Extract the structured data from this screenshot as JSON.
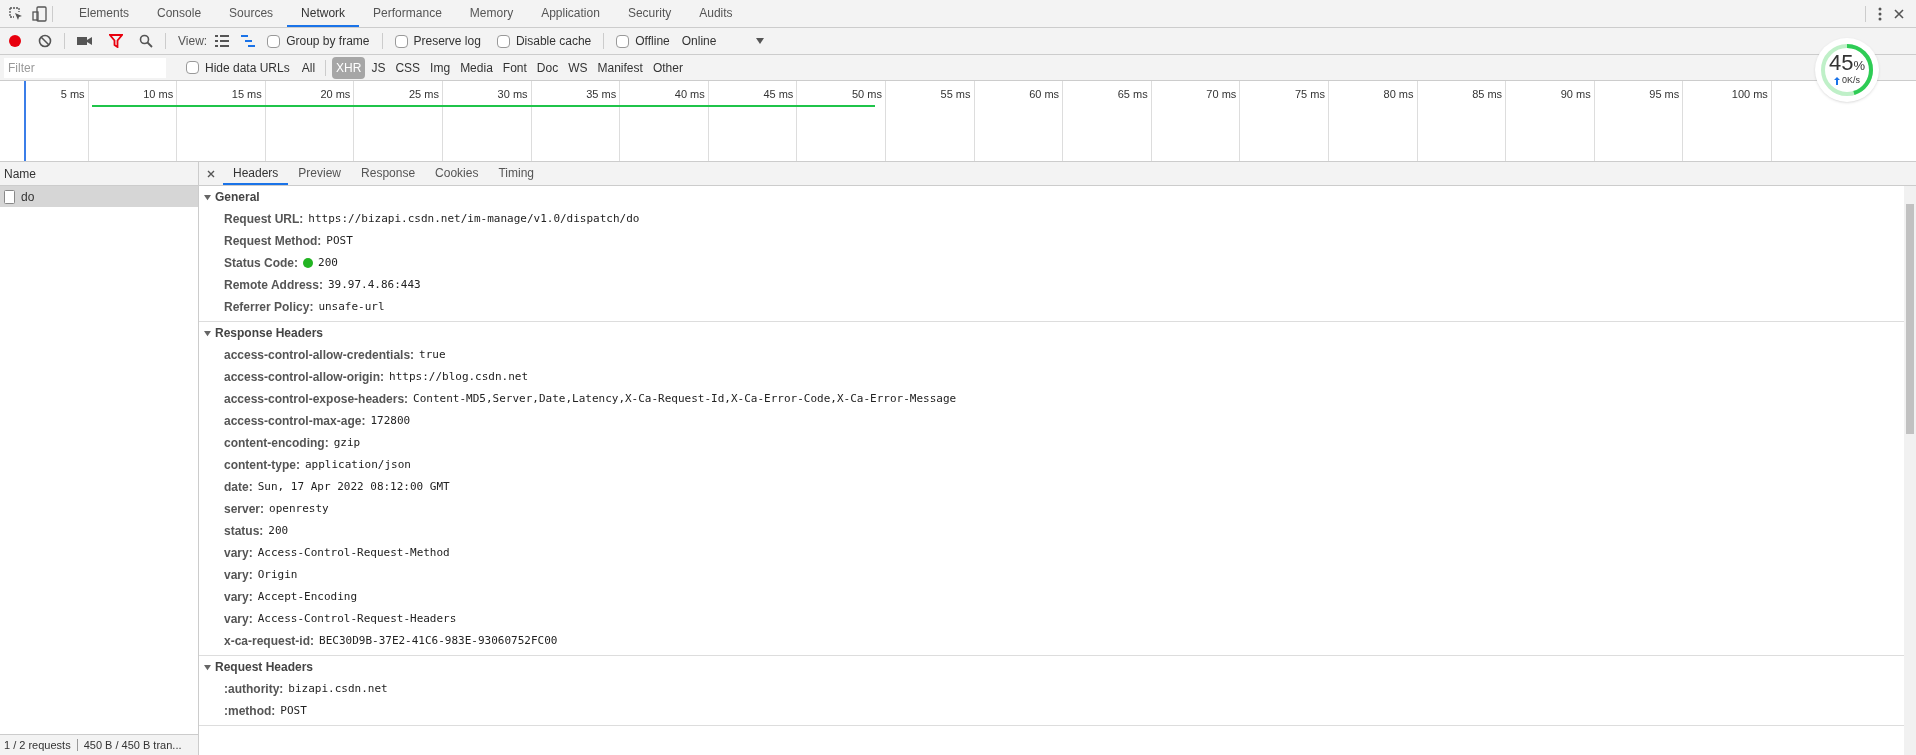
{
  "panel_tabs": [
    {
      "label": "Elements",
      "selected": false
    },
    {
      "label": "Console",
      "selected": false
    },
    {
      "label": "Sources",
      "selected": false
    },
    {
      "label": "Network",
      "selected": true
    },
    {
      "label": "Performance",
      "selected": false
    },
    {
      "label": "Memory",
      "selected": false
    },
    {
      "label": "Application",
      "selected": false
    },
    {
      "label": "Security",
      "selected": false
    },
    {
      "label": "Audits",
      "selected": false
    }
  ],
  "toolbar": {
    "recording": true,
    "view_label": "View:",
    "group_by_frame": {
      "label": "Group by frame",
      "checked": false
    },
    "preserve_log": {
      "label": "Preserve log",
      "checked": false
    },
    "disable_cache": {
      "label": "Disable cache",
      "checked": false
    },
    "offline": {
      "label": "Offline",
      "checked": false
    },
    "throttling": "Online"
  },
  "filter_bar": {
    "placeholder": "Filter",
    "hide_data_urls": {
      "label": "Hide data URLs",
      "checked": false
    },
    "types": [
      {
        "label": "All",
        "selected": false
      },
      {
        "label": "XHR",
        "selected": true
      },
      {
        "label": "JS",
        "selected": false
      },
      {
        "label": "CSS",
        "selected": false
      },
      {
        "label": "Img",
        "selected": false
      },
      {
        "label": "Media",
        "selected": false
      },
      {
        "label": "Font",
        "selected": false
      },
      {
        "label": "Doc",
        "selected": false
      },
      {
        "label": "WS",
        "selected": false
      },
      {
        "label": "Manifest",
        "selected": false
      },
      {
        "label": "Other",
        "selected": false
      }
    ]
  },
  "timeline": {
    "ticks": [
      "5 ms",
      "10 ms",
      "15 ms",
      "20 ms",
      "25 ms",
      "30 ms",
      "35 ms",
      "40 ms",
      "45 ms",
      "50 ms",
      "55 ms",
      "60 ms",
      "65 ms",
      "70 ms",
      "75 ms",
      "80 ms",
      "85 ms",
      "90 ms",
      "95 ms",
      "100 ms"
    ]
  },
  "speed_widget": {
    "percent": "45",
    "unit": "%",
    "rate": "0K/s",
    "level": 0.45
  },
  "requests": {
    "column": "Name",
    "rows": [
      {
        "name": "do",
        "selected": true
      }
    ]
  },
  "detail_tabs": [
    {
      "label": "Headers",
      "selected": true
    },
    {
      "label": "Preview",
      "selected": false
    },
    {
      "label": "Response",
      "selected": false
    },
    {
      "label": "Cookies",
      "selected": false
    },
    {
      "label": "Timing",
      "selected": false
    }
  ],
  "sections": [
    {
      "title": "General",
      "expanded": true,
      "rows": [
        {
          "key": "Request URL:",
          "value": "https://bizapi.csdn.net/im-manage/v1.0/dispatch/do"
        },
        {
          "key": "Request Method:",
          "value": "POST"
        },
        {
          "key": "Status Code:",
          "value": "200",
          "color": "#22b422"
        },
        {
          "key": "Remote Address:",
          "value": "39.97.4.86:443"
        },
        {
          "key": "Referrer Policy:",
          "value": "unsafe-url"
        }
      ]
    },
    {
      "title": "Response Headers",
      "expanded": true,
      "rows": [
        {
          "key": "access-control-allow-credentials:",
          "value": "true"
        },
        {
          "key": "access-control-allow-origin:",
          "value": "https://blog.csdn.net"
        },
        {
          "key": "access-control-expose-headers:",
          "value": "Content-MD5,Server,Date,Latency,X-Ca-Request-Id,X-Ca-Error-Code,X-Ca-Error-Message"
        },
        {
          "key": "access-control-max-age:",
          "value": "172800"
        },
        {
          "key": "content-encoding:",
          "value": "gzip"
        },
        {
          "key": "content-type:",
          "value": "application/json"
        },
        {
          "key": "date:",
          "value": "Sun, 17 Apr 2022 08:12:00 GMT"
        },
        {
          "key": "server:",
          "value": "openresty"
        },
        {
          "key": "status:",
          "value": "200"
        },
        {
          "key": "vary:",
          "value": "Access-Control-Request-Method"
        },
        {
          "key": "vary:",
          "value": "Origin"
        },
        {
          "key": "vary:",
          "value": "Accept-Encoding"
        },
        {
          "key": "vary:",
          "value": "Access-Control-Request-Headers"
        },
        {
          "key": "x-ca-request-id:",
          "value": "BEC30D9B-37E2-41C6-983E-93060752FC00"
        }
      ]
    },
    {
      "title": "Request Headers",
      "expanded": true,
      "rows": [
        {
          "key": ":authority:",
          "value": "bizapi.csdn.net"
        },
        {
          "key": ":method:",
          "value": "POST"
        }
      ]
    }
  ],
  "status_bar": {
    "requests": "1 / 2 requests",
    "transferred": "450 B / 450 B tran..."
  }
}
